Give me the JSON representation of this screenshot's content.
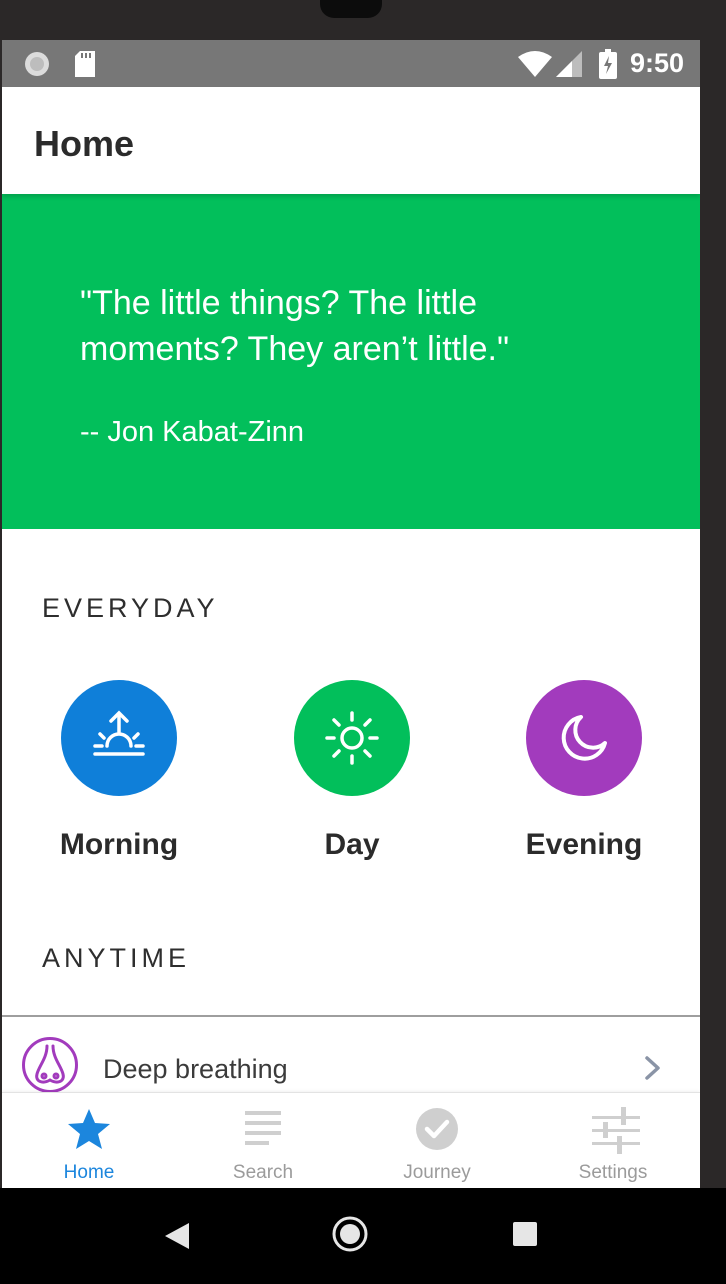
{
  "status_bar": {
    "time": "9:50"
  },
  "app_bar": {
    "title": "Home"
  },
  "quote": {
    "text": "\"The little things? The little moments? They aren’t little.\"",
    "author": "-- Jon Kabat-Zinn"
  },
  "sections": {
    "everyday_heading": "EVERYDAY",
    "anytime_heading": "ANYTIME"
  },
  "routines": [
    {
      "label": "Morning",
      "icon": "sunrise-icon",
      "color": "#0f7fd9"
    },
    {
      "label": "Day",
      "icon": "sun-icon",
      "color": "#02bf5b"
    },
    {
      "label": "Evening",
      "icon": "moon-icon",
      "color": "#a23bbd"
    }
  ],
  "anytime_items": [
    {
      "label": "Deep breathing",
      "icon": "nose-icon",
      "color": "#a23bbd"
    }
  ],
  "bottom_nav": [
    {
      "label": "Home",
      "icon": "star-icon",
      "active": true
    },
    {
      "label": "Search",
      "icon": "list-icon",
      "active": false
    },
    {
      "label": "Journey",
      "icon": "check-circle-icon",
      "active": false
    },
    {
      "label": "Settings",
      "icon": "sliders-icon",
      "active": false
    }
  ],
  "colors": {
    "accent_green": "#02bf5b",
    "active_blue": "#1c86dd",
    "inactive_gray": "#9b9b9b"
  }
}
